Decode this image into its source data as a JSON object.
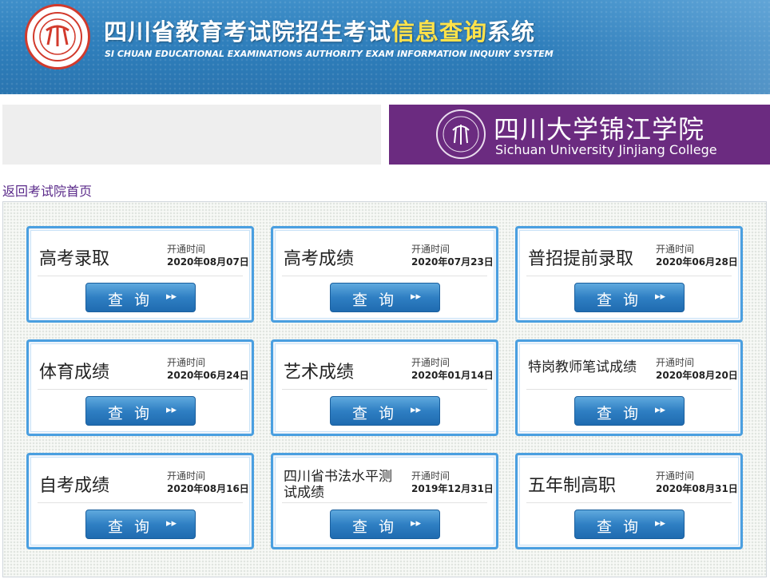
{
  "header": {
    "title_main": "四川省教育考试院招生考试",
    "title_highlight": "信息查询",
    "title_end": "系统",
    "subtitle_en": "SI CHUAN EDUCATIONAL EXAMINATIONS AUTHORITY EXAM INFORMATION INQUIRY SYSTEM",
    "logo_icon": "sceea-seal-logo"
  },
  "college": {
    "name_cn": "四川大学锦江学院",
    "name_en": "Sichuan University Jinjiang College",
    "emblem_icon": "college-emblem",
    "bg_color": "#6b2b80"
  },
  "nav": {
    "back_link": "返回考试院首页"
  },
  "cards": [
    {
      "name": "高考录取",
      "open_label": "开通时间",
      "open_date": "2020年08月07日",
      "button": "查询",
      "arrow": "▸▸"
    },
    {
      "name": "高考成绩",
      "open_label": "开通时间",
      "open_date": "2020年07月23日",
      "button": "查询",
      "arrow": "▸▸"
    },
    {
      "name": "普招提前录取",
      "open_label": "开通时间",
      "open_date": "2020年06月28日",
      "button": "查询",
      "arrow": "▸▸"
    },
    {
      "name": "体育成绩",
      "open_label": "开通时间",
      "open_date": "2020年06月24日",
      "button": "查询",
      "arrow": "▸▸"
    },
    {
      "name": "艺术成绩",
      "open_label": "开通时间",
      "open_date": "2020年01月14日",
      "button": "查询",
      "arrow": "▸▸"
    },
    {
      "name": "特岗教师笔试成绩",
      "open_label": "开通时间",
      "open_date": "2020年08月20日",
      "button": "查询",
      "arrow": "▸▸"
    },
    {
      "name": "自考成绩",
      "open_label": "开通时间",
      "open_date": "2020年08月16日",
      "button": "查询",
      "arrow": "▸▸"
    },
    {
      "name": "四川省书法水平测试成绩",
      "open_label": "开通时间",
      "open_date": "2019年12月31日",
      "button": "查询",
      "arrow": "▸▸"
    },
    {
      "name": "五年制高职",
      "open_label": "开通时间",
      "open_date": "2020年08月31日",
      "button": "查询",
      "arrow": "▸▸"
    }
  ],
  "colors": {
    "header_blue": "#2f7fbc",
    "title_highlight": "#ffe24a",
    "card_border": "#4a9fe0",
    "button_blue": "#2f7fc3",
    "link_purple": "#5a2a8a"
  }
}
